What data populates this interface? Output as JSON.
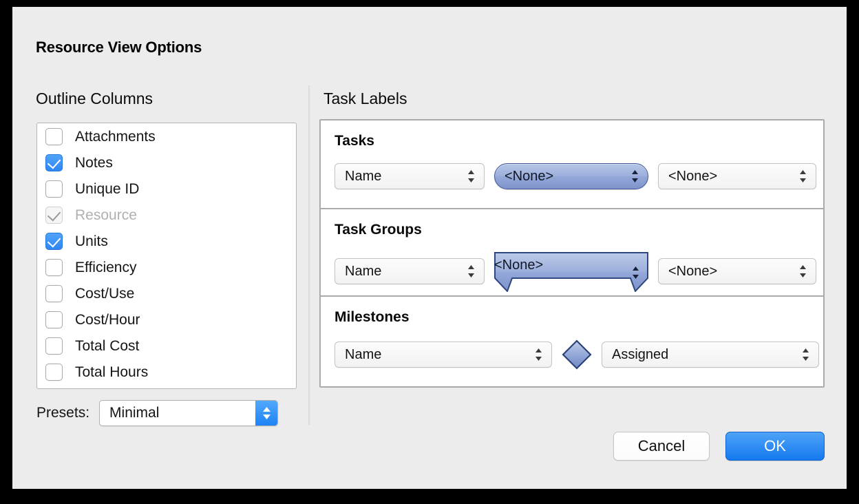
{
  "dialog": {
    "title": "Resource View Options"
  },
  "outline": {
    "heading": "Outline Columns",
    "items": [
      {
        "label": "Attachments",
        "checked": false,
        "disabled": false
      },
      {
        "label": "Notes",
        "checked": true,
        "disabled": false
      },
      {
        "label": "Unique ID",
        "checked": false,
        "disabled": false
      },
      {
        "label": "Resource",
        "checked": true,
        "disabled": true
      },
      {
        "label": "Units",
        "checked": true,
        "disabled": false
      },
      {
        "label": "Efficiency",
        "checked": false,
        "disabled": false
      },
      {
        "label": "Cost/Use",
        "checked": false,
        "disabled": false
      },
      {
        "label": "Cost/Hour",
        "checked": false,
        "disabled": false
      },
      {
        "label": "Total Cost",
        "checked": false,
        "disabled": false
      },
      {
        "label": "Total Hours",
        "checked": false,
        "disabled": false
      }
    ],
    "presets_label": "Presets:",
    "presets_value": "Minimal"
  },
  "task_labels": {
    "heading": "Task Labels",
    "sections": [
      {
        "title": "Tasks",
        "left_value": "Name",
        "center_value": "<None>",
        "right_value": "<None>",
        "center_shape": "task-bar"
      },
      {
        "title": "Task Groups",
        "left_value": "Name",
        "center_value": "<None>",
        "right_value": "<None>",
        "center_shape": "summary-bar"
      },
      {
        "title": "Milestones",
        "left_value": "Name",
        "center_value": "",
        "right_value": "Assigned",
        "center_shape": "milestone-diamond"
      }
    ]
  },
  "buttons": {
    "cancel": "Cancel",
    "ok": "OK"
  },
  "colors": {
    "accent_blue": "#1f84f5",
    "checkbox_blue": "#3b8bf5",
    "bar_blue": "#93a8d8",
    "bar_border": "#2f4780",
    "window_bg": "#ececec"
  }
}
